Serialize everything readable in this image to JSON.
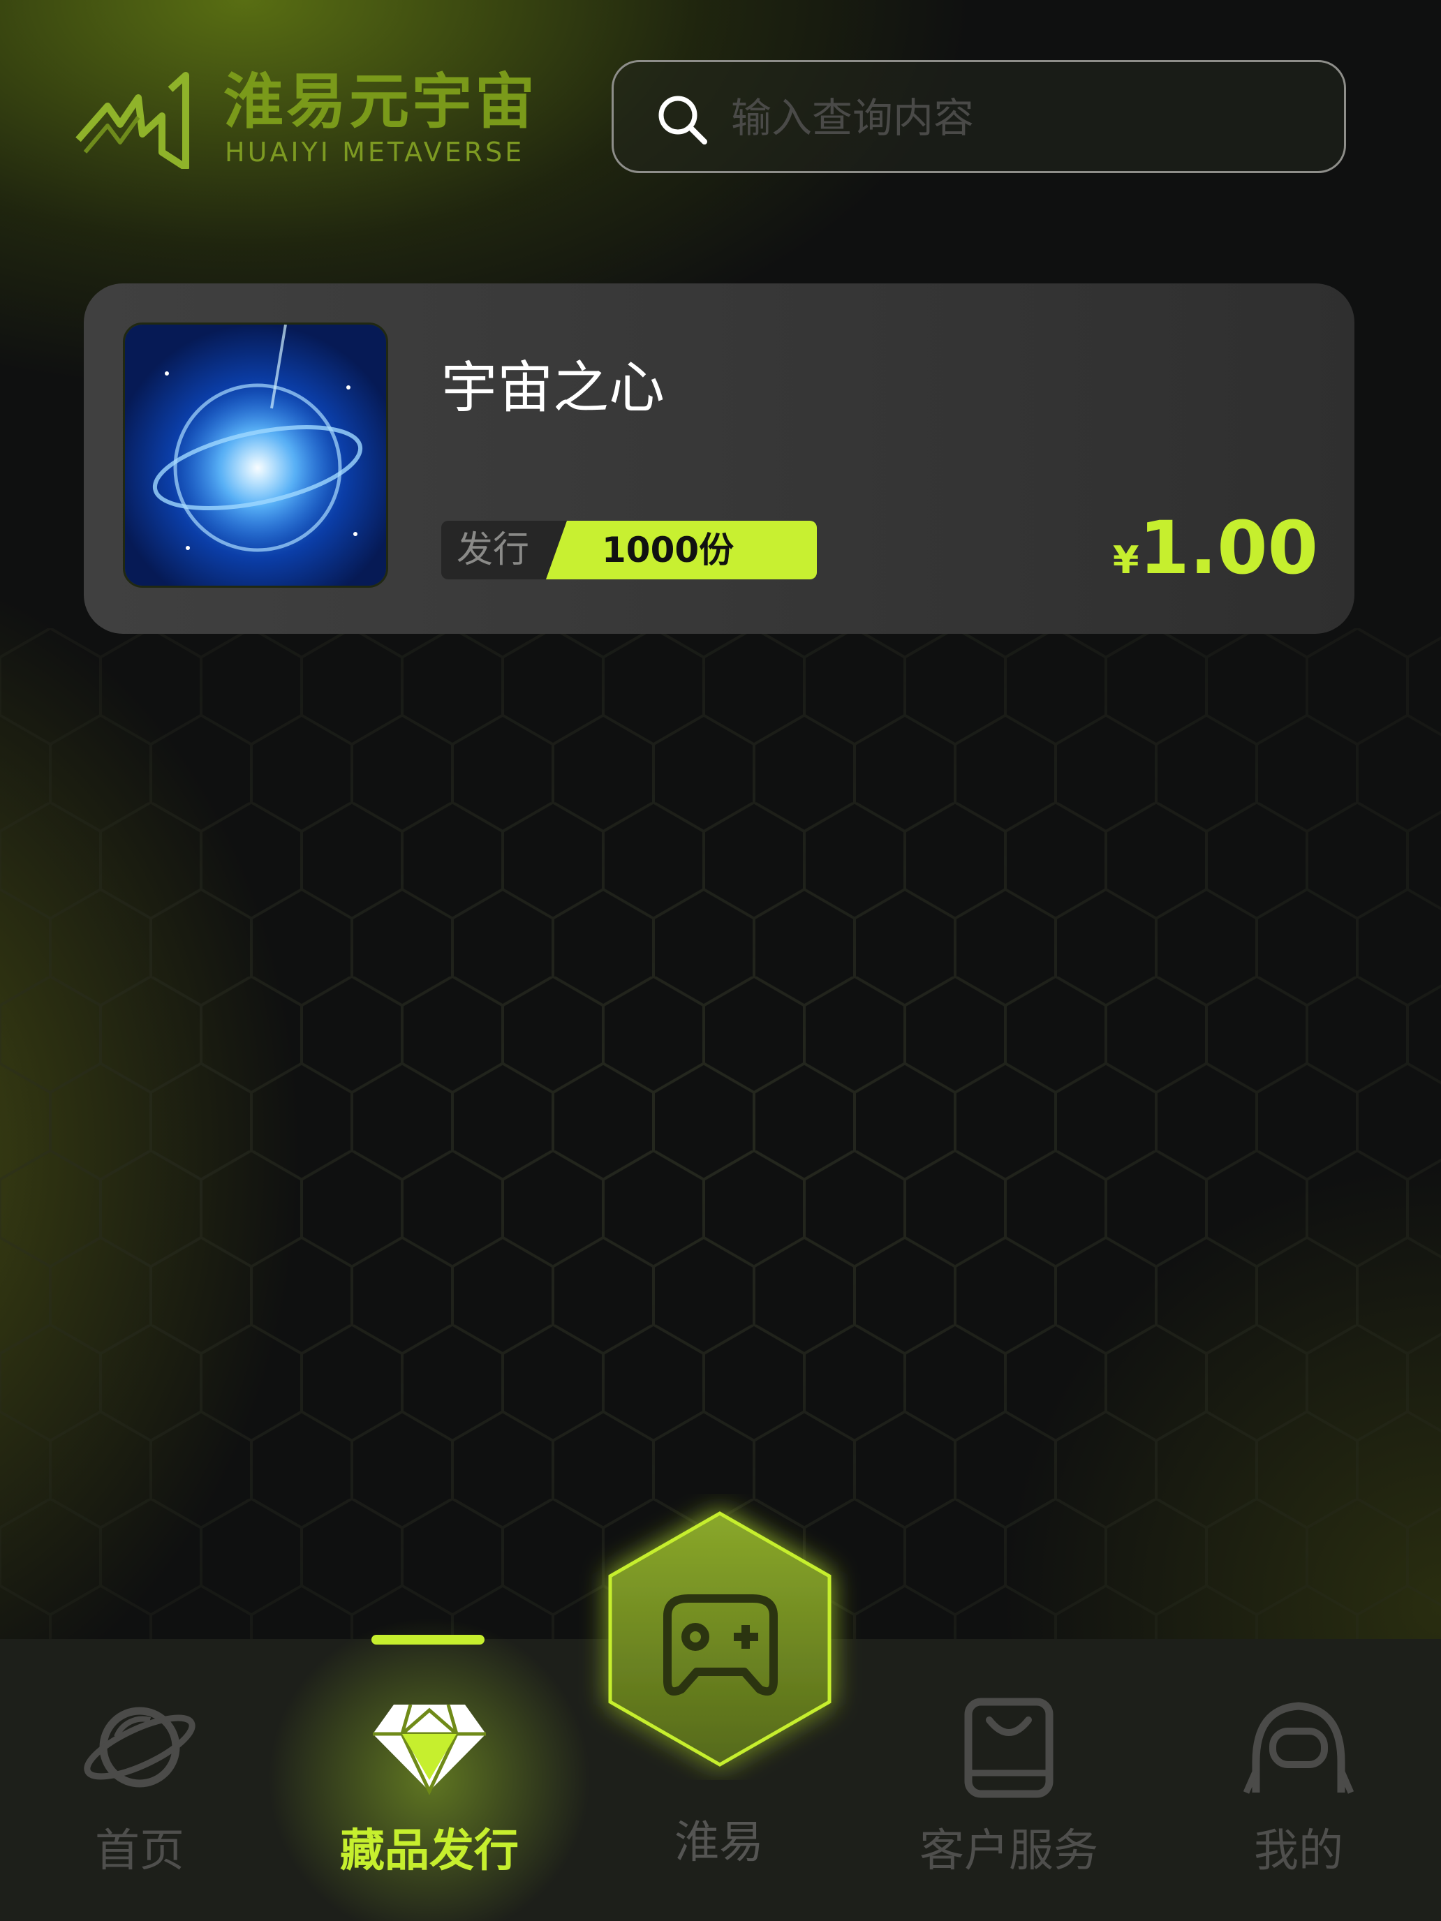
{
  "header": {
    "logo_cn": "淮易元宇宙",
    "logo_en": "HUAIYI METAVERSE",
    "search_placeholder": "输入查询内容"
  },
  "collection_card": {
    "title": "宇宙之心",
    "issue_label": "发行",
    "issue_count": "1000份",
    "currency": "¥",
    "price": "1.00"
  },
  "bottom_nav": {
    "items": [
      {
        "label": "首页",
        "icon": "planet-icon",
        "active": false
      },
      {
        "label": "藏品发行",
        "icon": "diamond-icon",
        "active": true
      },
      {
        "label": "淮易",
        "icon": "gamepad-icon",
        "active": false
      },
      {
        "label": "客户服务",
        "icon": "shopping-bag-icon",
        "active": false
      },
      {
        "label": "我的",
        "icon": "astronaut-icon",
        "active": false
      }
    ]
  },
  "colors": {
    "accent": "#c6ef2e",
    "background": "#0f1010",
    "card": "#3a3a3a",
    "navbar": "#1d1f1a"
  }
}
